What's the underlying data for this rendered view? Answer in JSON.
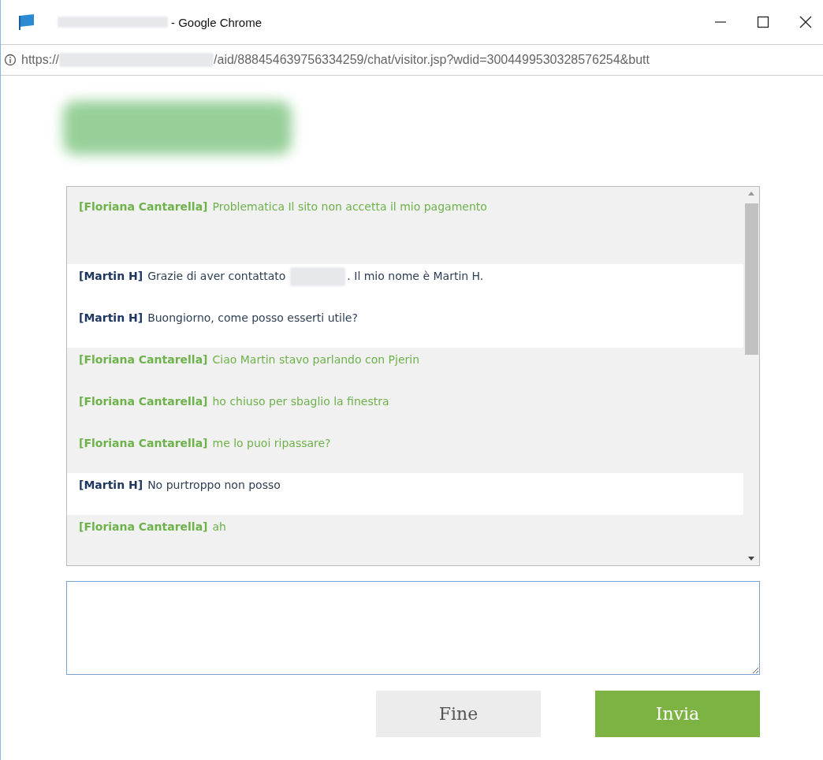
{
  "window": {
    "title": "- Google Chrome",
    "title_redacted": true
  },
  "address_bar": {
    "scheme": "https://",
    "host_redacted": true,
    "path": "/aid/888454639756334259/chat/visitor.jsp?wdid=300449953032857625​4&butt"
  },
  "chat": {
    "messages": [
      {
        "kind": "visitor",
        "author": "[Floriana Cantarella]",
        "text": "Problematica Il sito non accetta il mio pagamento",
        "tall": true
      },
      {
        "kind": "agent",
        "author": "[Martin H]",
        "text": "Grazie di aver contattato",
        "redacted_gap": true,
        "text_after": ". Il mio nome è Martin H."
      },
      {
        "kind": "agent",
        "author": "[Martin H]",
        "text": "Buongiorno, come posso esserti utile?"
      },
      {
        "kind": "visitor",
        "author": "[Floriana Cantarella]",
        "text": "Ciao Martin stavo parlando con Pjerin"
      },
      {
        "kind": "visitor",
        "author": "[Floriana Cantarella]",
        "text": "ho chiuso per sbaglio la finestra"
      },
      {
        "kind": "visitor",
        "author": "[Floriana Cantarella]",
        "text": "me lo puoi ripassare?"
      },
      {
        "kind": "agent",
        "author": "[Martin H]",
        "text": "No purtroppo non posso"
      },
      {
        "kind": "visitor",
        "author": "[Floriana Cantarella]",
        "text": "ah"
      }
    ]
  },
  "buttons": [
    {
      "label": "Fine",
      "kind": "secondary"
    },
    {
      "label": "Invia",
      "kind": "primary"
    }
  ]
}
